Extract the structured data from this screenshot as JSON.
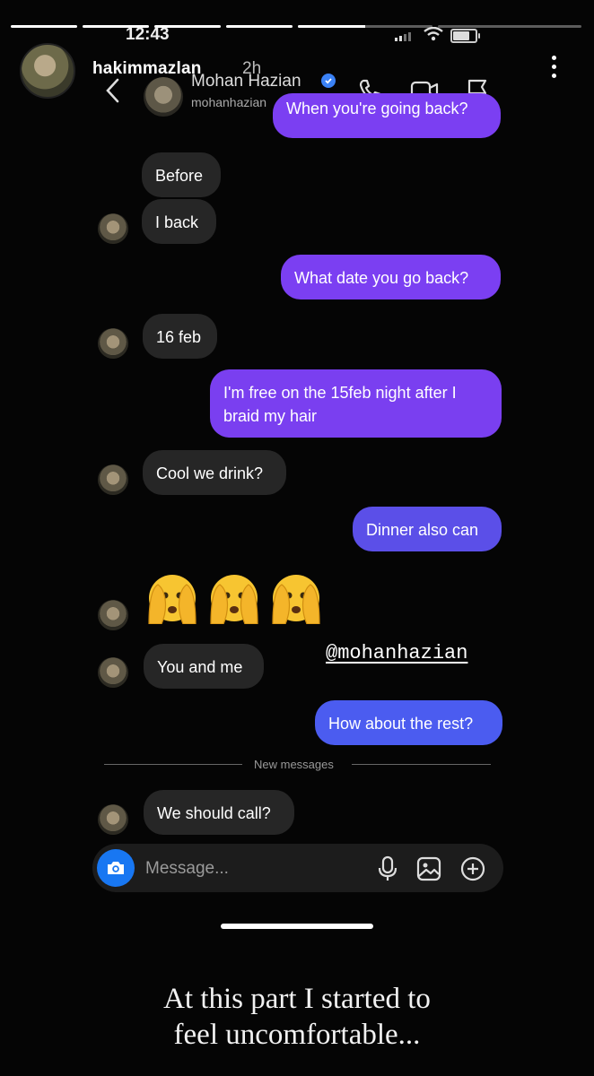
{
  "story": {
    "username": "hakimmazlan",
    "age": "2h",
    "progress": [
      1,
      1,
      1,
      1,
      0.5,
      0
    ]
  },
  "status_bar": {
    "time": "12:43"
  },
  "dm_header": {
    "name": "Mohan Hazian",
    "handle": "mohanhazian"
  },
  "messages": [
    {
      "from": "me",
      "text": "When you're going back?"
    },
    {
      "from": "them",
      "text": "Before"
    },
    {
      "from": "them",
      "text": "I back"
    },
    {
      "from": "me",
      "text": "What date you go back?"
    },
    {
      "from": "them",
      "text": "16 feb"
    },
    {
      "from": "me",
      "text": "I'm free on the 15feb night after I braid my hair"
    },
    {
      "from": "them",
      "text": "Cool we drink?"
    },
    {
      "from": "me",
      "text": "Dinner also can"
    },
    {
      "from": "them",
      "emoji": "face-with-hands-over-eyes",
      "count": 3
    },
    {
      "from": "them",
      "text": "You and me"
    },
    {
      "from": "me",
      "text": "How about the rest?"
    },
    {
      "from": "them",
      "text": "We should call?"
    }
  ],
  "mention_sticker": "@mohanhazian",
  "new_messages_label": "New messages",
  "composer": {
    "placeholder": "Message..."
  },
  "caption": {
    "line1": "At this part I started to",
    "line2": "feel uncomfortable..."
  },
  "colors": {
    "outgoing_purple": "#7b3ff2",
    "outgoing_indigo": "#5b4fe8",
    "outgoing_blue": "#4b5cf0",
    "incoming_gray": "#262626",
    "camera_blue": "#1877f2"
  }
}
